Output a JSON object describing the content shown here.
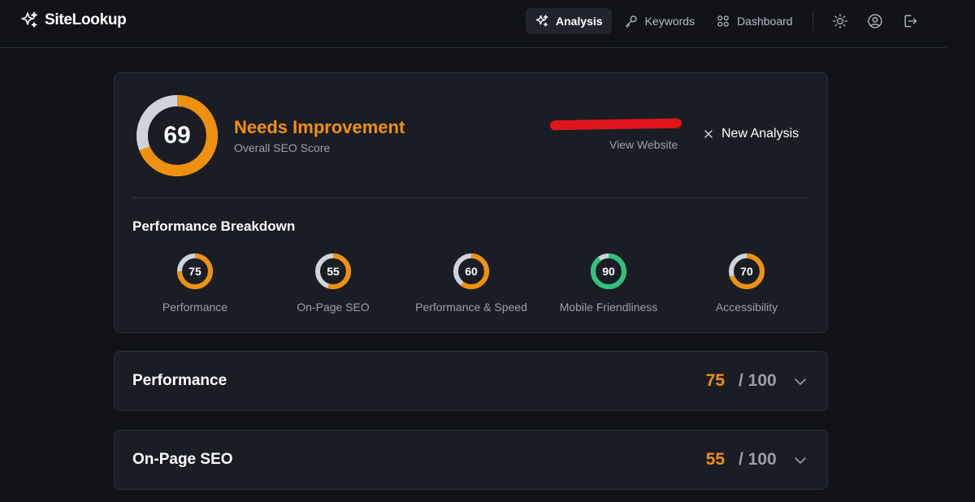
{
  "colors": {
    "accent": "#f0900f",
    "good": "#2ec27e",
    "track": "#cfd3da",
    "background": "#111318",
    "card": "#1a1d24"
  },
  "nav": {
    "brand": "SiteLookup",
    "brand_icon": "sparkles-icon",
    "items": [
      {
        "label": "Analysis",
        "icon": "sparkles-icon",
        "active": true
      },
      {
        "label": "Keywords",
        "icon": "key-icon",
        "active": false
      },
      {
        "label": "Dashboard",
        "icon": "grid-icon",
        "active": false
      }
    ],
    "actions": [
      "sun-icon",
      "user-circle-icon",
      "logout-icon"
    ]
  },
  "overview": {
    "score": "69",
    "score_value": 69,
    "status": "Needs Improvement",
    "subtitle": "Overall SEO Score",
    "view_website": "View Website",
    "new_analysis": "New Analysis"
  },
  "breakdown": {
    "title": "Performance Breakdown",
    "metrics": [
      {
        "label": "Performance",
        "score": "75",
        "value": 75,
        "color": "#f0900f"
      },
      {
        "label": "On-Page SEO",
        "score": "55",
        "value": 55,
        "color": "#f0900f"
      },
      {
        "label": "Performance & Speed",
        "score": "60",
        "value": 60,
        "color": "#f0900f"
      },
      {
        "label": "Mobile Friendliness",
        "score": "90",
        "value": 90,
        "color": "#2ec27e"
      },
      {
        "label": "Accessibility",
        "score": "70",
        "value": 70,
        "color": "#f0900f"
      }
    ]
  },
  "sections": [
    {
      "title": "Performance",
      "score": "75",
      "max": "/ 100"
    },
    {
      "title": "On-Page SEO",
      "score": "55",
      "max": "/ 100"
    }
  ]
}
